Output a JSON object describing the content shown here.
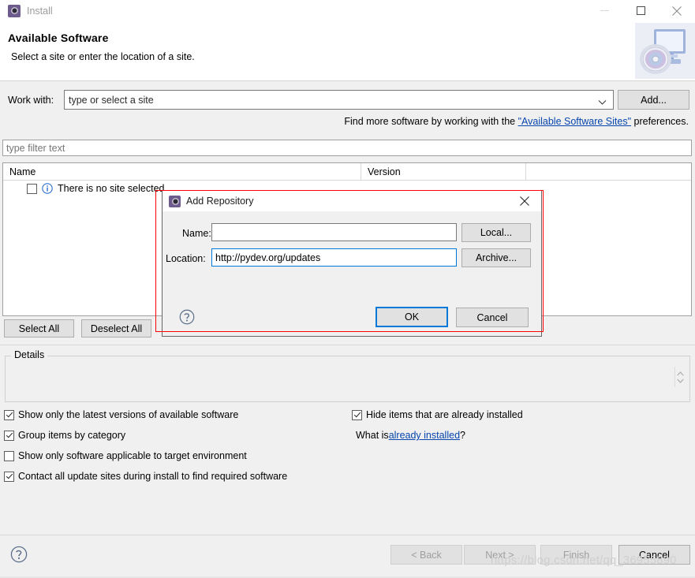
{
  "window": {
    "title": "Install",
    "icon": "eclipse-gear-icon",
    "controls": {
      "minimize": "minimize-icon",
      "maximize": "maximize-icon",
      "close": "close-icon"
    }
  },
  "header": {
    "title": "Available Software",
    "subtitle": "Select a site or enter the location of a site.",
    "art_icon": "computer-disc-icon"
  },
  "work_with": {
    "label": "Work with:",
    "combo_value": "type or select a site",
    "combo_placeholder": "type or select a site",
    "add_button": "Add...",
    "find_more_prefix": "Find more software by working with the ",
    "find_more_link": "\"Available Software Sites\"",
    "find_more_suffix": " preferences."
  },
  "filter": {
    "placeholder": "type filter text",
    "value": ""
  },
  "table": {
    "columns": [
      "Name",
      "Version"
    ],
    "rows": [
      {
        "checked": false,
        "icon": "info-icon",
        "name": "There is no site selected",
        "version": ""
      }
    ]
  },
  "selection_buttons": {
    "select_all": "Select All",
    "deselect_all": "Deselect All"
  },
  "details": {
    "legend": "Details",
    "content": "",
    "spinner_icon": "spinner-updown-icon"
  },
  "options": [
    {
      "label": "Show only the latest versions of available software",
      "checked": true
    },
    {
      "label": "Group items by category",
      "checked": true
    },
    {
      "label": "Show only software applicable to target environment",
      "checked": false
    },
    {
      "label": "Contact all update sites during install to find required software",
      "checked": true
    }
  ],
  "options_right": [
    {
      "label": "Hide items that are already installed",
      "checked": true
    }
  ],
  "already_installed": {
    "prefix": "What is ",
    "link": "already installed",
    "suffix": "?"
  },
  "footer": {
    "help_icon": "help-circle-icon",
    "buttons": [
      {
        "label": "< Back",
        "enabled": false
      },
      {
        "label": "Next >",
        "enabled": false
      },
      {
        "label": "Finish",
        "enabled": false
      },
      {
        "label": "Cancel",
        "enabled": true
      }
    ]
  },
  "watermark": "https://blog.csdn.net/qq_36955890",
  "dialog": {
    "title": "Add Repository",
    "icon": "eclipse-gear-icon",
    "close_icon": "close-icon",
    "name_label": "Name:",
    "name_value": "",
    "location_label": "Location:",
    "location_value": "http://pydev.org/updates",
    "local_button": "Local...",
    "archive_button": "Archive...",
    "help_icon": "help-circle-icon",
    "ok_button": "OK",
    "cancel_button": "Cancel"
  },
  "colors": {
    "accent_blue": "#0078d7",
    "link_blue": "#0645ad",
    "annotation_red": "#ff0000",
    "window_bg": "#f0f0f0",
    "field_bg": "#ffffff"
  }
}
